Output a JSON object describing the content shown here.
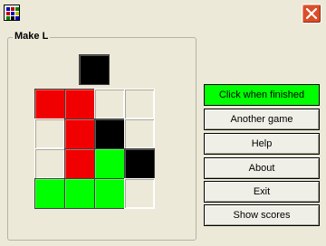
{
  "window": {
    "icon": "app-grid-icon",
    "close_icon": "close-icon"
  },
  "group": {
    "label": "Make L"
  },
  "target_cell": {
    "color": "black"
  },
  "grid": [
    [
      "red",
      "red",
      "empty",
      "empty"
    ],
    [
      "empty",
      "red",
      "black",
      "empty"
    ],
    [
      "empty",
      "red",
      "green",
      "black"
    ],
    [
      "green",
      "green",
      "green",
      "empty"
    ]
  ],
  "colors": {
    "red": "#f00000",
    "black": "#000000",
    "green": "#00ff00",
    "background": "#ece9d8"
  },
  "buttons": {
    "finished": "Click when finished",
    "another_game": "Another game",
    "help": "Help",
    "about": "About",
    "exit": "Exit",
    "show_scores": "Show scores"
  }
}
